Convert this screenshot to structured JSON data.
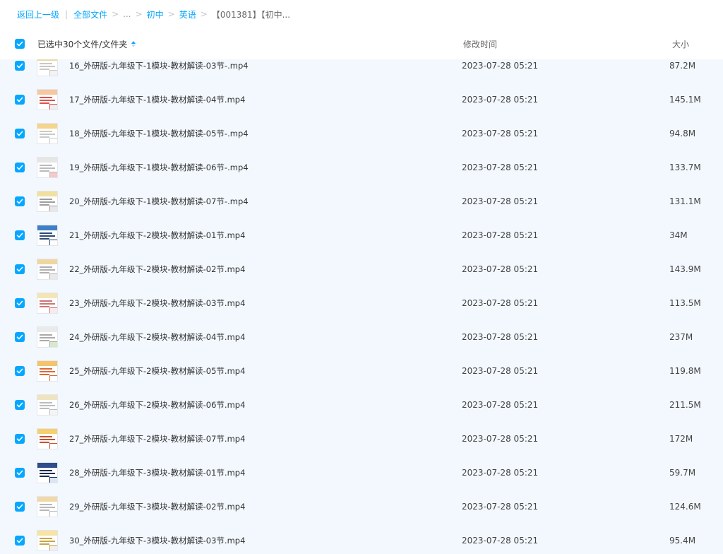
{
  "breadcrumb": {
    "back": "返回上一级",
    "divider": "|",
    "all_files": "全部文件",
    "sep": ">",
    "ellipsis": "...",
    "level1": "初中",
    "level2": "英语",
    "current": "【001381】【初中..."
  },
  "header": {
    "selected_label": "已选中30个文件/文件夹",
    "col_time": "修改时间",
    "col_size": "大小"
  },
  "colors": {
    "accent": "#06a7ff",
    "row_bg": "#f2f8fe"
  },
  "files": [
    {
      "name": "16_外研版-九年级下-1模块-教材解读-03节-.mp4",
      "time": "2023-07-28 05:21",
      "size": "87.2M"
    },
    {
      "name": "17_外研版-九年级下-1模块-教材解读-04节.mp4",
      "time": "2023-07-28 05:21",
      "size": "145.1M"
    },
    {
      "name": "18_外研版-九年级下-1模块-教材解读-05节-.mp4",
      "time": "2023-07-28 05:21",
      "size": "94.8M"
    },
    {
      "name": "19_外研版-九年级下-1模块-教材解读-06节-.mp4",
      "time": "2023-07-28 05:21",
      "size": "133.7M"
    },
    {
      "name": "20_外研版-九年级下-1模块-教材解读-07节-.mp4",
      "time": "2023-07-28 05:21",
      "size": "131.1M"
    },
    {
      "name": "21_外研版-九年级下-2模块-教材解读-01节.mp4",
      "time": "2023-07-28 05:21",
      "size": "34M"
    },
    {
      "name": "22_外研版-九年级下-2模块-教材解读-02节.mp4",
      "time": "2023-07-28 05:21",
      "size": "143.9M"
    },
    {
      "name": "23_外研版-九年级下-2模块-教材解读-03节.mp4",
      "time": "2023-07-28 05:21",
      "size": "113.5M"
    },
    {
      "name": "24_外研版-九年级下-2模块-教材解读-04节.mp4",
      "time": "2023-07-28 05:21",
      "size": "237M"
    },
    {
      "name": "25_外研版-九年级下-2模块-教材解读-05节.mp4",
      "time": "2023-07-28 05:21",
      "size": "119.8M"
    },
    {
      "name": "26_外研版-九年级下-2模块-教材解读-06节.mp4",
      "time": "2023-07-28 05:21",
      "size": "211.5M"
    },
    {
      "name": "27_外研版-九年级下-2模块-教材解读-07节.mp4",
      "time": "2023-07-28 05:21",
      "size": "172M"
    },
    {
      "name": "28_外研版-九年级下-3模块-教材解读-01节.mp4",
      "time": "2023-07-28 05:21",
      "size": "59.7M"
    },
    {
      "name": "29_外研版-九年级下-3模块-教材解读-02节.mp4",
      "time": "2023-07-28 05:21",
      "size": "124.6M"
    },
    {
      "name": "30_外研版-九年级下-3模块-教材解读-03节.mp4",
      "time": "2023-07-28 05:21",
      "size": "95.4M"
    }
  ]
}
